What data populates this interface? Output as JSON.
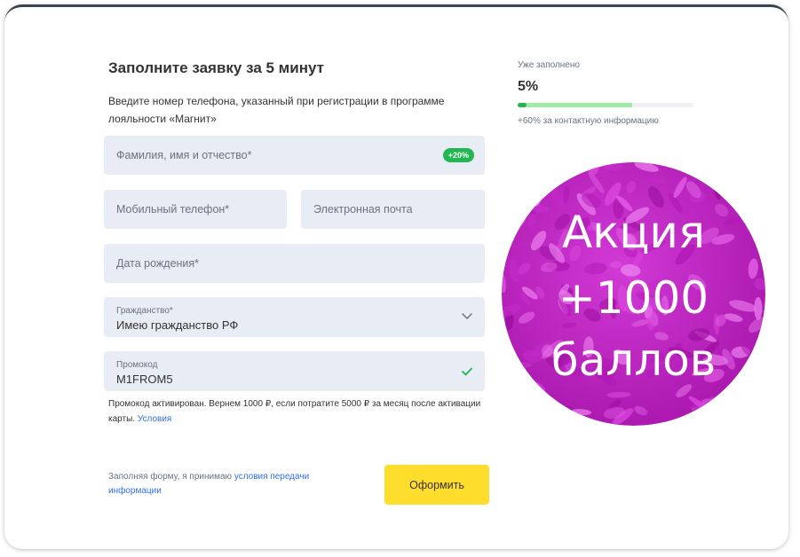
{
  "form": {
    "title": "Заполните заявку за 5 минут",
    "subtitle": "Введите номер телефона, указанный при регистрации в программе лояльности «Магнит»",
    "fullname": {
      "placeholder": "Фамилия, имя и отчество*",
      "badge": "+20%"
    },
    "phone": {
      "placeholder": "Мобильный телефон*"
    },
    "email": {
      "placeholder": "Электронная почта"
    },
    "birthdate": {
      "placeholder": "Дата рождения*"
    },
    "citizenship": {
      "label": "Гражданство*",
      "value": "Имею гражданство РФ"
    },
    "promo": {
      "label": "Промокод",
      "value": "M1FROM5"
    },
    "promo_note": "Промокод активирован. Вернем 1000 ₽, если потратите 5000 ₽ за месяц после активации карты.",
    "promo_note_link": "Условия",
    "consent_text": "Заполняя форму, я принимаю",
    "consent_link": "условия передачи информации",
    "submit_label": "Оформить"
  },
  "progress": {
    "label": "Уже заполнено",
    "value_text": "5%",
    "filled_fraction": 0.05,
    "pending_fraction": 0.6,
    "hint": "+60% за контактную информацию",
    "colors": {
      "filled": "#21b650",
      "pending": "#9eeba9",
      "track": "#eef0f3"
    }
  },
  "promo_banner": {
    "lines": [
      "Акция",
      "+1000",
      "баллов"
    ],
    "colors": {
      "base": "#c020c4",
      "text": "#ffffff"
    }
  },
  "icons": {
    "citizenship_dropdown": "chevron-down-icon",
    "promo_status": "check-icon"
  },
  "colors": {
    "accent_button": "#ffdd2d",
    "field_bg": "#e7ecf5",
    "link": "#336fee",
    "success": "#21b650"
  }
}
